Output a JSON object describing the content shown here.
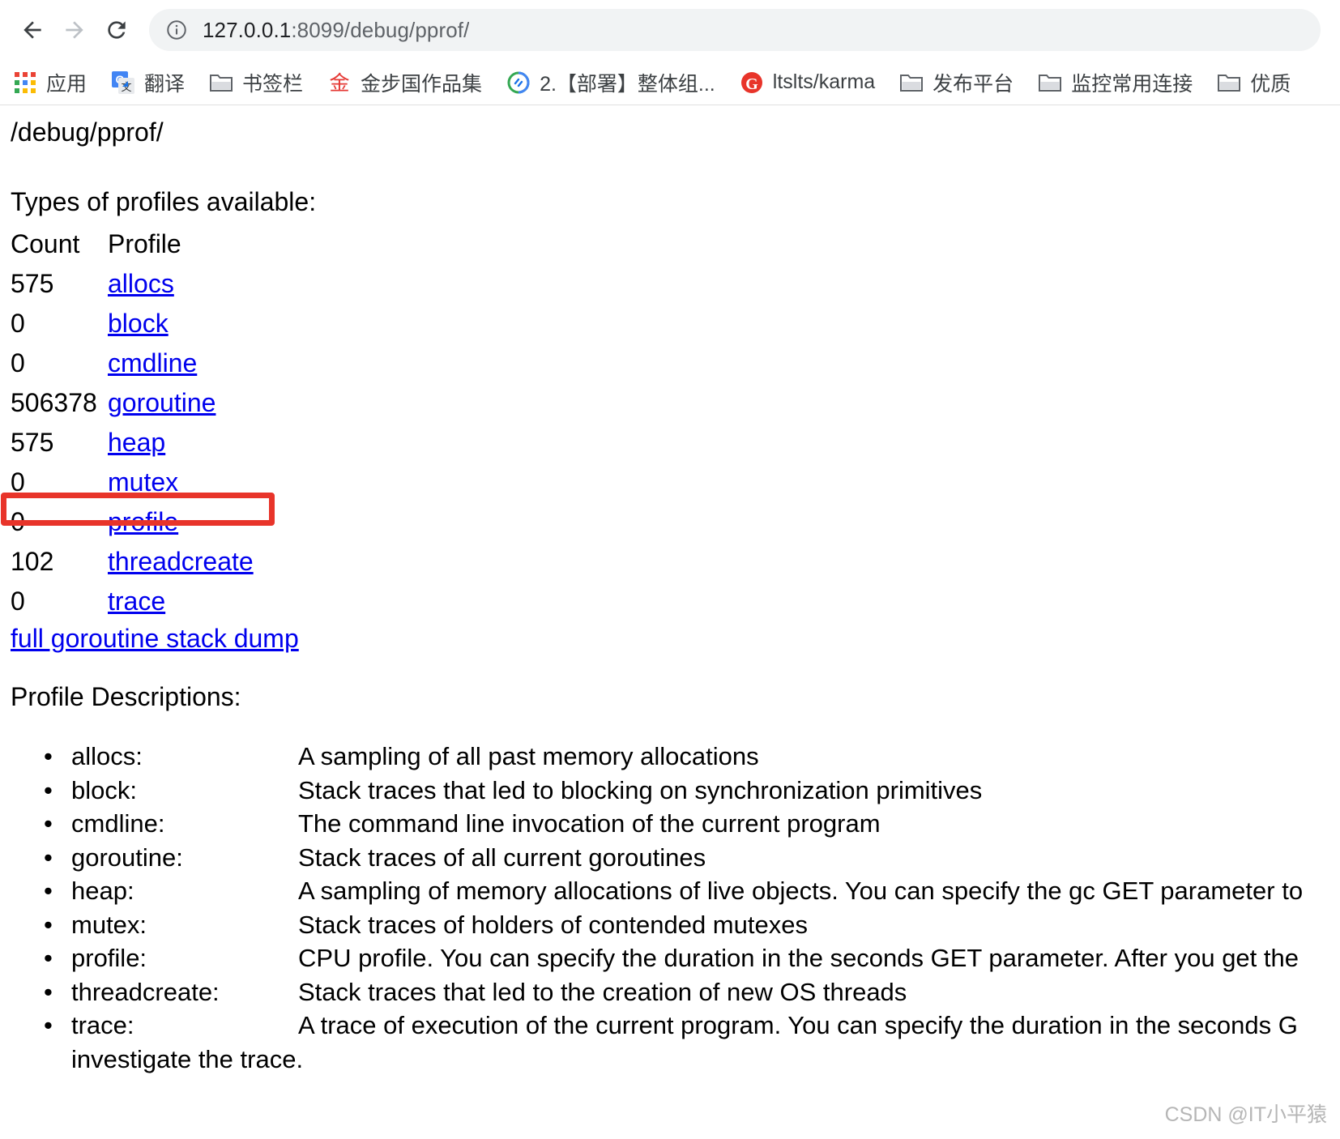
{
  "browser": {
    "nav": {
      "back_label": "Back",
      "forward_label": "Forward",
      "reload_label": "Reload"
    },
    "omnibox": {
      "info_icon": "info-circle-icon",
      "url_host": "127.0.0.1",
      "url_rest": ":8099/debug/pprof/",
      "full_url": "127.0.0.1:8099/debug/pprof/"
    },
    "bookmarks": [
      {
        "label": "应用",
        "icon": "apps-grid-icon"
      },
      {
        "label": "翻译",
        "icon": "google-translate-icon"
      },
      {
        "label": "书签栏",
        "icon": "folder-icon"
      },
      {
        "label": "金步国作品集",
        "icon": "jin-character-icon"
      },
      {
        "label": "2.【部署】整体组...",
        "icon": "link-circle-icon"
      },
      {
        "label": "ltslts/karma",
        "icon": "gitlab-g-icon"
      },
      {
        "label": "发布平台",
        "icon": "folder-icon"
      },
      {
        "label": "监控常用连接",
        "icon": "folder-icon"
      },
      {
        "label": "优质",
        "icon": "folder-icon"
      }
    ]
  },
  "page": {
    "title": "/debug/pprof/",
    "types_heading": "Types of profiles available:",
    "table": {
      "headers": [
        "Count",
        "Profile"
      ],
      "rows": [
        {
          "count": "575",
          "profile": "allocs"
        },
        {
          "count": "0",
          "profile": "block"
        },
        {
          "count": "0",
          "profile": "cmdline"
        },
        {
          "count": "506378",
          "profile": "goroutine"
        },
        {
          "count": "575",
          "profile": "heap"
        },
        {
          "count": "0",
          "profile": "mutex"
        },
        {
          "count": "0",
          "profile": "profile"
        },
        {
          "count": "102",
          "profile": "threadcreate"
        },
        {
          "count": "0",
          "profile": "trace"
        }
      ]
    },
    "highlight": {
      "color": "#e8342a",
      "target_row": "goroutine"
    },
    "stack_dump_link": "full goroutine stack dump",
    "descriptions_heading": "Profile Descriptions:",
    "descriptions": [
      {
        "term": "allocs:",
        "text": "A sampling of all past memory allocations"
      },
      {
        "term": "block:",
        "text": "Stack traces that led to blocking on synchronization primitives"
      },
      {
        "term": "cmdline:",
        "text": "The command line invocation of the current program"
      },
      {
        "term": "goroutine:",
        "text": "Stack traces of all current goroutines"
      },
      {
        "term": "heap:",
        "text": "A sampling of memory allocations of live objects. You can specify the gc GET parameter to"
      },
      {
        "term": "mutex:",
        "text": "Stack traces of holders of contended mutexes"
      },
      {
        "term": "profile:",
        "text": "CPU profile. You can specify the duration in the seconds GET parameter. After you get the"
      },
      {
        "term": "threadcreate:",
        "text": "Stack traces that led to the creation of new OS threads"
      },
      {
        "term": "trace:",
        "text": "A trace of execution of the current program. You can specify the duration in the seconds G"
      },
      {
        "term": "",
        "text": "investigate the trace."
      }
    ],
    "link_color": "#0000ee"
  },
  "watermark": "CSDN @IT小平猿"
}
